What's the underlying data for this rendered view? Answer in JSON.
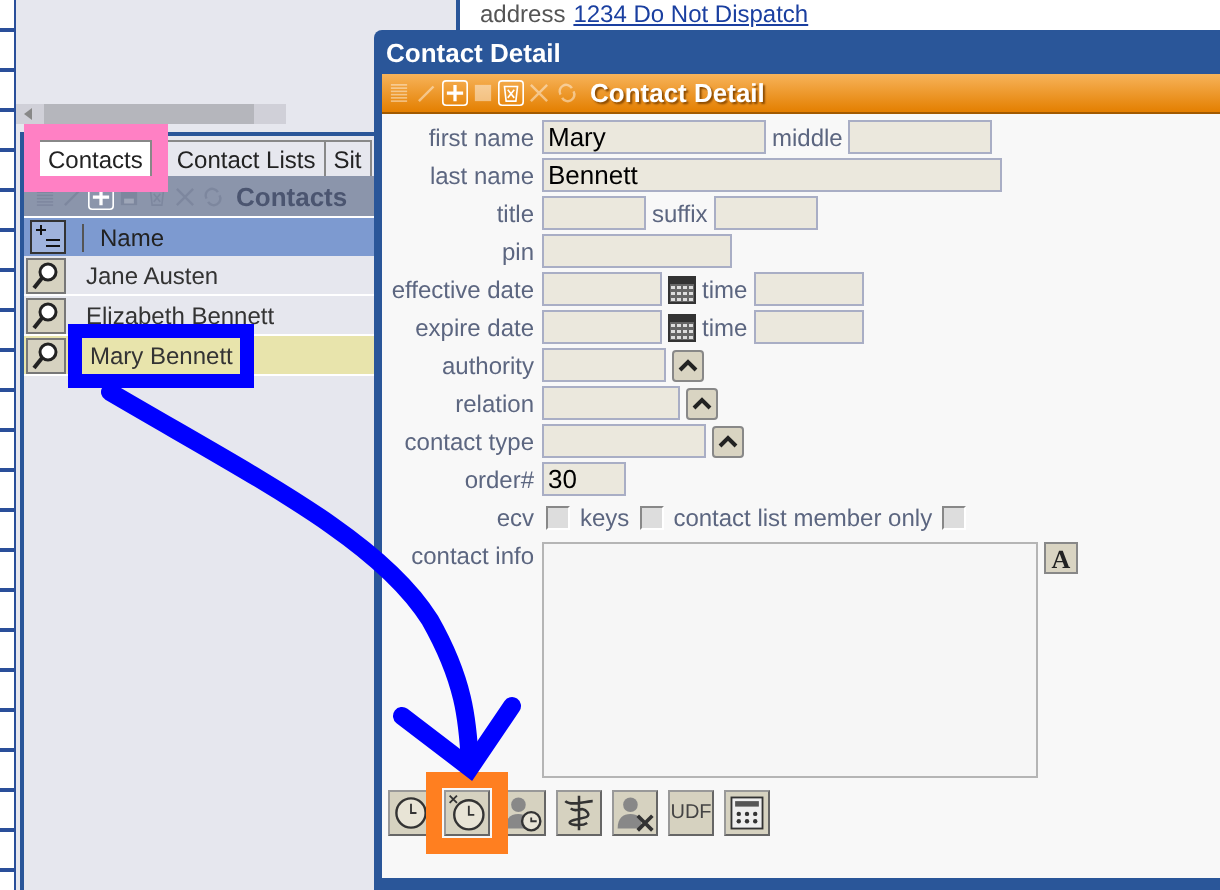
{
  "background": {
    "address_label": "address",
    "address_link": "1234 Do Not Dispatch",
    "tabs": [
      {
        "label": "Contacts",
        "selected": true,
        "highlighted": true
      },
      {
        "label": "Contact Lists",
        "selected": false,
        "highlighted": false
      },
      {
        "label": "Sit",
        "selected": false,
        "highlighted": false
      }
    ],
    "toolbar_title": "Contacts",
    "column": "Name",
    "rows": [
      {
        "name": "Jane Austen",
        "selected": false,
        "highlighted": false
      },
      {
        "name": "Elizabeth Bennett",
        "selected": false,
        "highlighted": false
      },
      {
        "name": "Mary Bennett",
        "selected": true,
        "highlighted": true
      }
    ]
  },
  "dialog": {
    "title": "Contact Detail",
    "toolbar_title": "Contact Detail",
    "fields": [
      {
        "label": "first name",
        "parts": [
          {
            "kind": "input",
            "value": "Mary"
          },
          {
            "kind": "label",
            "text": "middle"
          },
          {
            "kind": "input"
          }
        ]
      },
      {
        "label": "last name",
        "parts": [
          {
            "kind": "input",
            "value": "Bennett"
          }
        ]
      },
      {
        "label": "title",
        "parts": [
          {
            "kind": "input"
          },
          {
            "kind": "label",
            "text": "suffix"
          },
          {
            "kind": "input"
          }
        ]
      },
      {
        "label": "pin",
        "parts": [
          {
            "kind": "input"
          }
        ]
      },
      {
        "label": "effective date",
        "parts": [
          {
            "kind": "input"
          },
          {
            "kind": "calendar"
          },
          {
            "kind": "label",
            "text": "time"
          },
          {
            "kind": "input"
          }
        ]
      },
      {
        "label": "expire date",
        "parts": [
          {
            "kind": "input"
          },
          {
            "kind": "calendar"
          },
          {
            "kind": "label",
            "text": "time"
          },
          {
            "kind": "input"
          }
        ]
      },
      {
        "label": "authority",
        "parts": [
          {
            "kind": "input"
          },
          {
            "kind": "picker"
          }
        ]
      },
      {
        "label": "relation",
        "parts": [
          {
            "kind": "input"
          },
          {
            "kind": "picker"
          }
        ]
      },
      {
        "label": "contact type",
        "parts": [
          {
            "kind": "input"
          },
          {
            "kind": "picker"
          }
        ]
      },
      {
        "label": "order#",
        "parts": [
          {
            "kind": "input",
            "value": "30"
          }
        ]
      },
      {
        "label": "ecv",
        "parts": [
          {
            "kind": "checkbox",
            "checked": false
          },
          {
            "kind": "label",
            "text": "keys"
          },
          {
            "kind": "checkbox",
            "checked": false
          },
          {
            "kind": "label",
            "text": "contact list member only"
          },
          {
            "kind": "checkbox",
            "checked": false
          }
        ]
      }
    ],
    "contact_info": {
      "label": "contact info",
      "format_button": "A"
    },
    "buttons": [
      {
        "kind": "clock",
        "highlighted": false
      },
      {
        "kind": "clock-x",
        "highlighted": true
      },
      {
        "kind": "person-clock",
        "highlighted": false
      },
      {
        "kind": "caduceus",
        "highlighted": false
      },
      {
        "kind": "person-x",
        "highlighted": false
      },
      {
        "kind": "text",
        "label": "UDF",
        "highlighted": false
      },
      {
        "kind": "calculator",
        "highlighted": false
      }
    ]
  }
}
